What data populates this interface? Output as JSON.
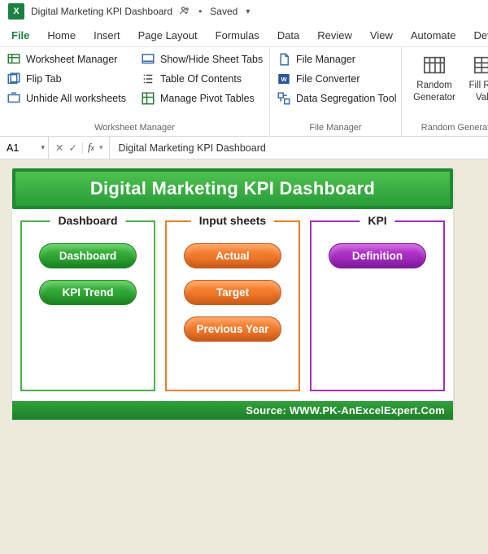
{
  "titlebar": {
    "doc_title": "Digital Marketing KPI Dashboard",
    "saved_label": "Saved"
  },
  "menubar": {
    "tabs": [
      "File",
      "Home",
      "Insert",
      "Page Layout",
      "Formulas",
      "Data",
      "Review",
      "View",
      "Automate",
      "Dev"
    ]
  },
  "ribbon": {
    "group1": {
      "label": "Worksheet Manager",
      "items": [
        "Worksheet Manager",
        "Flip Tab",
        "Unhide All worksheets"
      ]
    },
    "group2": {
      "items": [
        "Show/Hide Sheet Tabs",
        "Table Of Contents",
        "Manage Pivot Tables"
      ]
    },
    "group3": {
      "label": "File Manager",
      "items": [
        "File Manager",
        "File Converter",
        "Data Segregation Tool"
      ]
    },
    "group4": {
      "label": "Random Generat",
      "item1_line1": "Random",
      "item1_line2": "Generator",
      "item2_line1": "Fill Ran",
      "item2_line2": "Valu"
    }
  },
  "formulabar": {
    "cell_ref": "A1",
    "formula": "Digital Marketing KPI Dashboard"
  },
  "content": {
    "title": "Digital Marketing KPI Dashboard",
    "dashboard": {
      "legend": "Dashboard",
      "items": [
        "Dashboard",
        "KPI Trend"
      ]
    },
    "inputs": {
      "legend": "Input sheets",
      "items": [
        "Actual",
        "Target",
        "Previous Year"
      ]
    },
    "kpi": {
      "legend": "KPI",
      "items": [
        "Definition"
      ]
    },
    "source": "Source: WWW.PK-AnExcelExpert.Com"
  }
}
